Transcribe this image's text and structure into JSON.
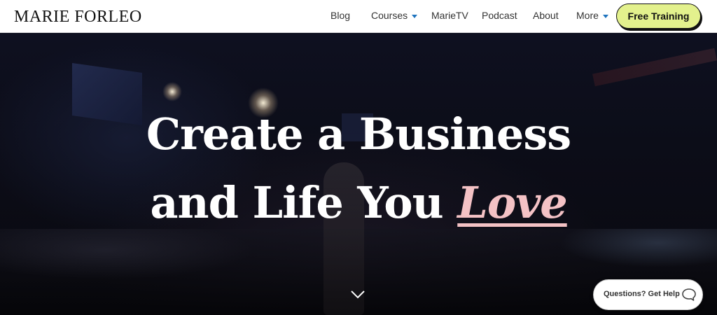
{
  "header": {
    "logo": "MARIE FORLEO",
    "nav": {
      "blog": "Blog",
      "courses": "Courses",
      "marietv": "MarieTV",
      "podcast": "Podcast",
      "about": "About",
      "more": "More"
    },
    "cta_label": "Free Training"
  },
  "hero": {
    "headline_line1": "Create a Business",
    "headline_line2_prefix": "and Life You ",
    "headline_accent": "Love"
  },
  "help_widget": {
    "label": "Questions? Get Help"
  },
  "colors": {
    "cta_background": "#e3f18d",
    "accent_pink": "#f4c2c5",
    "caret_blue": "#1e73be"
  },
  "icons": [
    "chevron-down-icon",
    "chat-bubble-icon",
    "caret-down-icon"
  ]
}
